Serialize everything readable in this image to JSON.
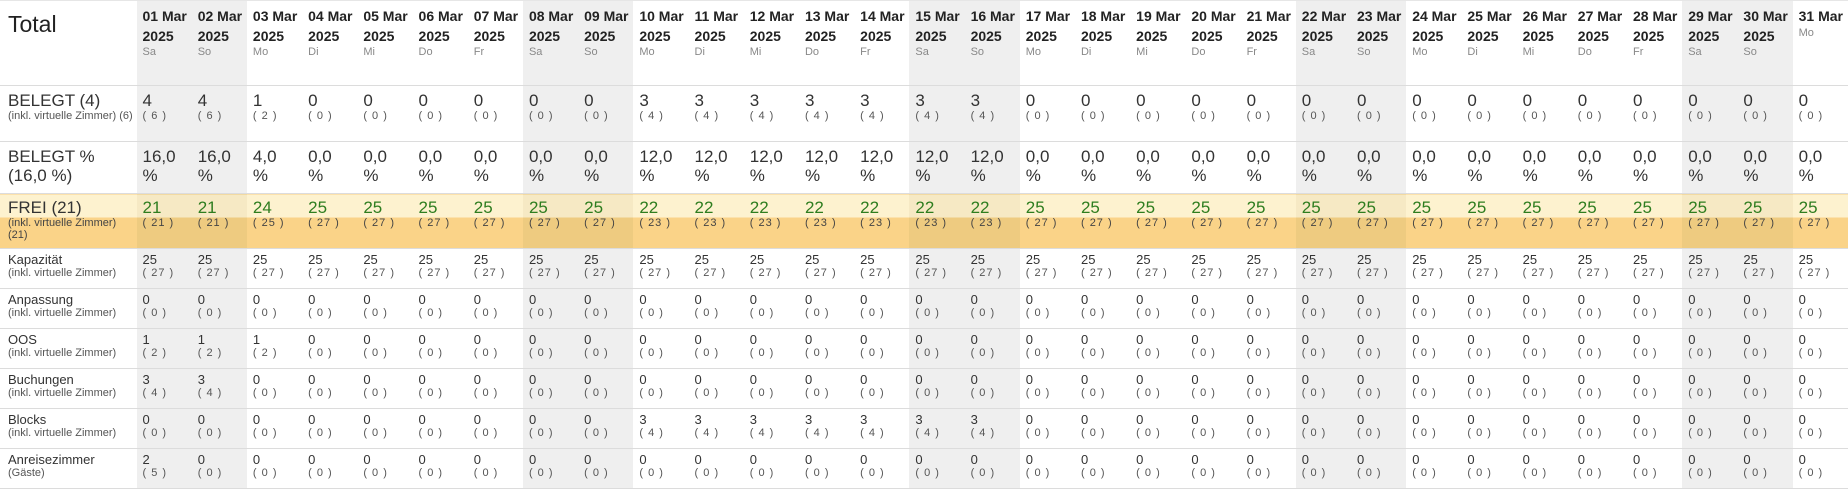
{
  "header_label": "Total",
  "days": [
    {
      "d": "01 Mar",
      "y": "2025",
      "w": "Sa",
      "we": true
    },
    {
      "d": "02 Mar",
      "y": "2025",
      "w": "So",
      "we": true
    },
    {
      "d": "03 Mar",
      "y": "2025",
      "w": "Mo",
      "we": false
    },
    {
      "d": "04 Mar",
      "y": "2025",
      "w": "Di",
      "we": false
    },
    {
      "d": "05 Mar",
      "y": "2025",
      "w": "Mi",
      "we": false
    },
    {
      "d": "06 Mar",
      "y": "2025",
      "w": "Do",
      "we": false
    },
    {
      "d": "07 Mar",
      "y": "2025",
      "w": "Fr",
      "we": false
    },
    {
      "d": "08 Mar",
      "y": "2025",
      "w": "Sa",
      "we": true
    },
    {
      "d": "09 Mar",
      "y": "2025",
      "w": "So",
      "we": true
    },
    {
      "d": "10 Mar",
      "y": "2025",
      "w": "Mo",
      "we": false
    },
    {
      "d": "11 Mar",
      "y": "2025",
      "w": "Di",
      "we": false
    },
    {
      "d": "12 Mar",
      "y": "2025",
      "w": "Mi",
      "we": false
    },
    {
      "d": "13 Mar",
      "y": "2025",
      "w": "Do",
      "we": false
    },
    {
      "d": "14 Mar",
      "y": "2025",
      "w": "Fr",
      "we": false
    },
    {
      "d": "15 Mar",
      "y": "2025",
      "w": "Sa",
      "we": true
    },
    {
      "d": "16 Mar",
      "y": "2025",
      "w": "So",
      "we": true
    },
    {
      "d": "17 Mar",
      "y": "2025",
      "w": "Mo",
      "we": false
    },
    {
      "d": "18 Mar",
      "y": "2025",
      "w": "Di",
      "we": false
    },
    {
      "d": "19 Mar",
      "y": "2025",
      "w": "Mi",
      "we": false
    },
    {
      "d": "20 Mar",
      "y": "2025",
      "w": "Do",
      "we": false
    },
    {
      "d": "21 Mar",
      "y": "2025",
      "w": "Fr",
      "we": false
    },
    {
      "d": "22 Mar",
      "y": "2025",
      "w": "Sa",
      "we": true
    },
    {
      "d": "23 Mar",
      "y": "2025",
      "w": "So",
      "we": true
    },
    {
      "d": "24 Mar",
      "y": "2025",
      "w": "Mo",
      "we": false
    },
    {
      "d": "25 Mar",
      "y": "2025",
      "w": "Di",
      "we": false
    },
    {
      "d": "26 Mar",
      "y": "2025",
      "w": "Mi",
      "we": false
    },
    {
      "d": "27 Mar",
      "y": "2025",
      "w": "Do",
      "we": false
    },
    {
      "d": "28 Mar",
      "y": "2025",
      "w": "Fr",
      "we": false
    },
    {
      "d": "29 Mar",
      "y": "2025",
      "w": "Sa",
      "we": true
    },
    {
      "d": "30 Mar",
      "y": "2025",
      "w": "So",
      "we": true
    },
    {
      "d": "31 Mar",
      "y": "",
      "w": "Mo",
      "we": false
    }
  ],
  "rows": [
    {
      "id": "belegt",
      "cls": "r-big",
      "label": "BELEGT (4)",
      "sub": "(inkl. virtuelle Zimmer) (6)",
      "main": [
        "4",
        "4",
        "1",
        "0",
        "0",
        "0",
        "0",
        "0",
        "0",
        "3",
        "3",
        "3",
        "3",
        "3",
        "3",
        "3",
        "0",
        "0",
        "0",
        "0",
        "0",
        "0",
        "0",
        "0",
        "0",
        "0",
        "0",
        "0",
        "0",
        "0",
        "0"
      ],
      "s": [
        "6",
        "6",
        "2",
        "0",
        "0",
        "0",
        "0",
        "0",
        "0",
        "4",
        "4",
        "4",
        "4",
        "4",
        "4",
        "4",
        "0",
        "0",
        "0",
        "0",
        "0",
        "0",
        "0",
        "0",
        "0",
        "0",
        "0",
        "0",
        "0",
        "0",
        "0"
      ]
    },
    {
      "id": "belegt-pct",
      "cls": "r-pct",
      "label": "BELEGT %",
      "sub2": "(16,0 %)",
      "main": [
        "16,0",
        "16,0",
        "4,0",
        "0,0",
        "0,0",
        "0,0",
        "0,0",
        "0,0",
        "0,0",
        "12,0",
        "12,0",
        "12,0",
        "12,0",
        "12,0",
        "12,0",
        "12,0",
        "0,0",
        "0,0",
        "0,0",
        "0,0",
        "0,0",
        "0,0",
        "0,0",
        "0,0",
        "0,0",
        "0,0",
        "0,0",
        "0,0",
        "0,0",
        "0,0",
        "0,0"
      ],
      "pct": "%"
    },
    {
      "id": "frei",
      "cls": "r-free",
      "label": "FREI (21)",
      "sub": "(inkl. virtuelle Zimmer) (21)",
      "main": [
        "21",
        "21",
        "24",
        "25",
        "25",
        "25",
        "25",
        "25",
        "25",
        "22",
        "22",
        "22",
        "22",
        "22",
        "22",
        "22",
        "25",
        "25",
        "25",
        "25",
        "25",
        "25",
        "25",
        "25",
        "25",
        "25",
        "25",
        "25",
        "25",
        "25",
        "25"
      ],
      "s": [
        "21",
        "21",
        "25",
        "27",
        "27",
        "27",
        "27",
        "27",
        "27",
        "23",
        "23",
        "23",
        "23",
        "23",
        "23",
        "23",
        "27",
        "27",
        "27",
        "27",
        "27",
        "27",
        "27",
        "27",
        "27",
        "27",
        "27",
        "27",
        "27",
        "27",
        "27"
      ]
    },
    {
      "id": "kapazitaet",
      "cls": "r-sm",
      "label": "Kapazität",
      "sub": "(inkl. virtuelle Zimmer)",
      "main": [
        "25",
        "25",
        "25",
        "25",
        "25",
        "25",
        "25",
        "25",
        "25",
        "25",
        "25",
        "25",
        "25",
        "25",
        "25",
        "25",
        "25",
        "25",
        "25",
        "25",
        "25",
        "25",
        "25",
        "25",
        "25",
        "25",
        "25",
        "25",
        "25",
        "25",
        "25"
      ],
      "s": [
        "27",
        "27",
        "27",
        "27",
        "27",
        "27",
        "27",
        "27",
        "27",
        "27",
        "27",
        "27",
        "27",
        "27",
        "27",
        "27",
        "27",
        "27",
        "27",
        "27",
        "27",
        "27",
        "27",
        "27",
        "27",
        "27",
        "27",
        "27",
        "27",
        "27",
        "27"
      ]
    },
    {
      "id": "anpassung",
      "cls": "r-sm",
      "label": "Anpassung",
      "sub": "(inkl. virtuelle Zimmer)",
      "main": [
        "0",
        "0",
        "0",
        "0",
        "0",
        "0",
        "0",
        "0",
        "0",
        "0",
        "0",
        "0",
        "0",
        "0",
        "0",
        "0",
        "0",
        "0",
        "0",
        "0",
        "0",
        "0",
        "0",
        "0",
        "0",
        "0",
        "0",
        "0",
        "0",
        "0",
        "0"
      ],
      "s": [
        "0",
        "0",
        "0",
        "0",
        "0",
        "0",
        "0",
        "0",
        "0",
        "0",
        "0",
        "0",
        "0",
        "0",
        "0",
        "0",
        "0",
        "0",
        "0",
        "0",
        "0",
        "0",
        "0",
        "0",
        "0",
        "0",
        "0",
        "0",
        "0",
        "0",
        "0"
      ]
    },
    {
      "id": "oos",
      "cls": "r-sm",
      "label": "OOS",
      "sub": "(inkl. virtuelle Zimmer)",
      "main": [
        "1",
        "1",
        "1",
        "0",
        "0",
        "0",
        "0",
        "0",
        "0",
        "0",
        "0",
        "0",
        "0",
        "0",
        "0",
        "0",
        "0",
        "0",
        "0",
        "0",
        "0",
        "0",
        "0",
        "0",
        "0",
        "0",
        "0",
        "0",
        "0",
        "0",
        "0"
      ],
      "s": [
        "2",
        "2",
        "2",
        "0",
        "0",
        "0",
        "0",
        "0",
        "0",
        "0",
        "0",
        "0",
        "0",
        "0",
        "0",
        "0",
        "0",
        "0",
        "0",
        "0",
        "0",
        "0",
        "0",
        "0",
        "0",
        "0",
        "0",
        "0",
        "0",
        "0",
        "0"
      ]
    },
    {
      "id": "buchungen",
      "cls": "r-sm",
      "label": "Buchungen",
      "sub": "(inkl. virtuelle Zimmer)",
      "main": [
        "3",
        "3",
        "0",
        "0",
        "0",
        "0",
        "0",
        "0",
        "0",
        "0",
        "0",
        "0",
        "0",
        "0",
        "0",
        "0",
        "0",
        "0",
        "0",
        "0",
        "0",
        "0",
        "0",
        "0",
        "0",
        "0",
        "0",
        "0",
        "0",
        "0",
        "0"
      ],
      "s": [
        "4",
        "4",
        "0",
        "0",
        "0",
        "0",
        "0",
        "0",
        "0",
        "0",
        "0",
        "0",
        "0",
        "0",
        "0",
        "0",
        "0",
        "0",
        "0",
        "0",
        "0",
        "0",
        "0",
        "0",
        "0",
        "0",
        "0",
        "0",
        "0",
        "0",
        "0"
      ]
    },
    {
      "id": "blocks",
      "cls": "r-sm",
      "label": "Blocks",
      "sub": "(inkl. virtuelle Zimmer)",
      "main": [
        "0",
        "0",
        "0",
        "0",
        "0",
        "0",
        "0",
        "0",
        "0",
        "3",
        "3",
        "3",
        "3",
        "3",
        "3",
        "3",
        "0",
        "0",
        "0",
        "0",
        "0",
        "0",
        "0",
        "0",
        "0",
        "0",
        "0",
        "0",
        "0",
        "0",
        "0"
      ],
      "s": [
        "0",
        "0",
        "0",
        "0",
        "0",
        "0",
        "0",
        "0",
        "0",
        "4",
        "4",
        "4",
        "4",
        "4",
        "4",
        "4",
        "0",
        "0",
        "0",
        "0",
        "0",
        "0",
        "0",
        "0",
        "0",
        "0",
        "0",
        "0",
        "0",
        "0",
        "0"
      ]
    },
    {
      "id": "anreisezimmer",
      "cls": "r-sm",
      "label": "Anreisezimmer",
      "sub": "(Gäste)",
      "main": [
        "2",
        "0",
        "0",
        "0",
        "0",
        "0",
        "0",
        "0",
        "0",
        "0",
        "0",
        "0",
        "0",
        "0",
        "0",
        "0",
        "0",
        "0",
        "0",
        "0",
        "0",
        "0",
        "0",
        "0",
        "0",
        "0",
        "0",
        "0",
        "0",
        "0",
        "0"
      ],
      "s": [
        "5",
        "0",
        "0",
        "0",
        "0",
        "0",
        "0",
        "0",
        "0",
        "0",
        "0",
        "0",
        "0",
        "0",
        "0",
        "0",
        "0",
        "0",
        "0",
        "0",
        "0",
        "0",
        "0",
        "0",
        "0",
        "0",
        "0",
        "0",
        "0",
        "0",
        "0"
      ]
    }
  ]
}
